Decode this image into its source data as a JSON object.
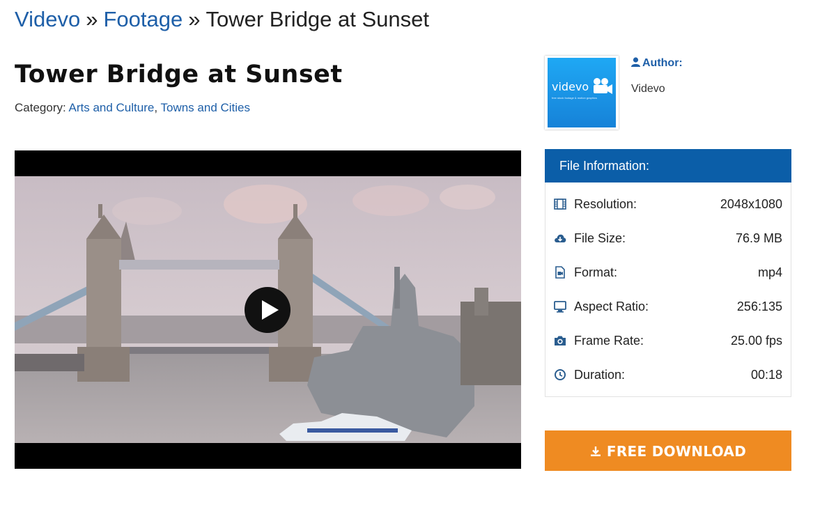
{
  "breadcrumb": {
    "home": "Videvo",
    "separator": "»",
    "section": "Footage",
    "current": "Tower Bridge at Sunset"
  },
  "page": {
    "title": "Tower Bridge at Sunset",
    "category_label": "Category:",
    "categories": [
      "Arts and Culture",
      "Towns and Cities"
    ],
    "category_separator": ","
  },
  "video": {
    "thumbnail_icon": "tower-bridge-scene",
    "play_icon": "play-icon"
  },
  "author": {
    "label": "Author:",
    "label_icon": "user-icon",
    "name": "Videvo",
    "logo_icon": "videvo-logo",
    "logo_text": "videvo",
    "logo_tagline": "free stock footage & motion graphics"
  },
  "file_info": {
    "header": "File Information:",
    "rows": [
      {
        "icon": "film-icon",
        "label": "Resolution:",
        "value": "2048x1080"
      },
      {
        "icon": "cloud-download-icon",
        "label": "File Size:",
        "value": "76.9 MB"
      },
      {
        "icon": "file-video-icon",
        "label": "Format:",
        "value": "mp4"
      },
      {
        "icon": "monitor-icon",
        "label": "Aspect Ratio:",
        "value": "256:135"
      },
      {
        "icon": "camera-icon",
        "label": "Frame Rate:",
        "value": "25.00 fps"
      },
      {
        "icon": "clock-icon",
        "label": "Duration:",
        "value": "00:18"
      }
    ]
  },
  "download": {
    "label": "FREE DOWNLOAD",
    "icon": "download-icon"
  },
  "colors": {
    "link": "#1e5fa8",
    "panel_header": "#0b5ea8",
    "download": "#ef8b22"
  }
}
